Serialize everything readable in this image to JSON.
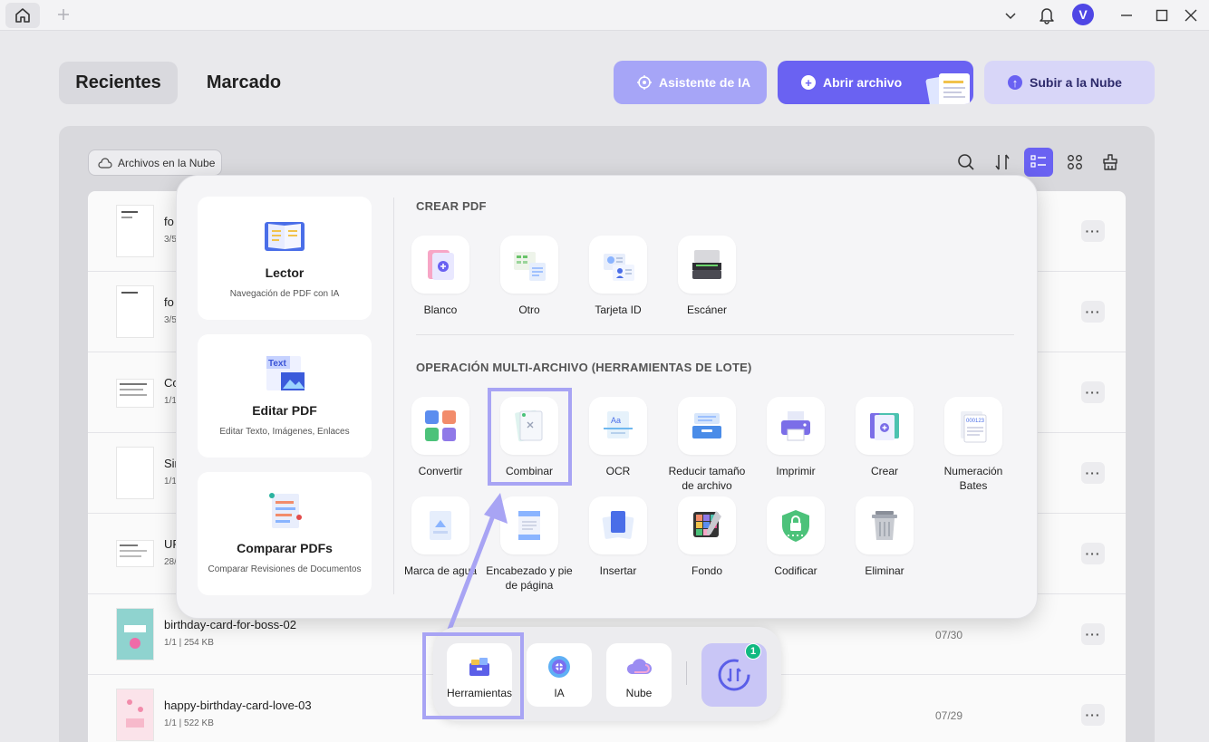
{
  "header": {
    "tab_recent": "Recientes",
    "tab_marked": "Marcado",
    "btn_ai": "Asistente de IA",
    "btn_open": "Abrir archivo",
    "btn_cloud": "Subir a la Nube",
    "avatar_letter": "V"
  },
  "toolbar": {
    "cloud_chip": "Archivos en la Nube"
  },
  "files": [
    {
      "name": "fo",
      "meta": "3/5",
      "date": ""
    },
    {
      "name": "fo",
      "meta": "3/5",
      "date": ""
    },
    {
      "name": "Co",
      "meta": "1/1",
      "date": ""
    },
    {
      "name": "Sir",
      "meta": "1/1",
      "date": ""
    },
    {
      "name": "UP",
      "meta": "28/",
      "date": ""
    },
    {
      "name": "birthday-card-for-boss-02",
      "meta": "1/1 | 254 KB",
      "date": "07/30"
    },
    {
      "name": "happy-birthday-card-love-03",
      "meta": "1/1 | 522 KB",
      "date": "07/29"
    }
  ],
  "row_more": "···",
  "popup": {
    "cards": [
      {
        "title": "Lector",
        "sub": "Navegación de PDF con IA"
      },
      {
        "title": "Editar PDF",
        "sub": "Editar Texto, Imágenes, Enlaces"
      },
      {
        "title": "Comparar PDFs",
        "sub": "Comparar Revisiones de Documentos"
      }
    ],
    "edit_icon_text": "Text",
    "create_title": "CREAR PDF",
    "create_tools": [
      "Blanco",
      "Otro",
      "Tarjeta ID",
      "Escáner"
    ],
    "batch_title": "OPERACIÓN MULTI-ARCHIVO (HERRAMIENTAS DE LOTE)",
    "batch_row1": [
      "Convertir",
      "Combinar",
      "OCR",
      "Reducir tamaño de archivo",
      "Imprimir",
      "Crear",
      "Numeración Bates"
    ],
    "batch_row2": [
      "Marca de agua",
      "Encabezado y pie de página",
      "Insertar",
      "Fondo",
      "Codificar",
      "Eliminar"
    ],
    "ocr_icon_text": "Aa",
    "bates_icon_text": "000123"
  },
  "dock": {
    "items": [
      "Herramientas",
      "IA",
      "Nube"
    ],
    "sync_badge": "1"
  },
  "colors": {
    "accent": "#6a62f2",
    "accent_light": "#a6a5f7",
    "highlight": "#a8a4f4",
    "badge": "#10b981"
  }
}
